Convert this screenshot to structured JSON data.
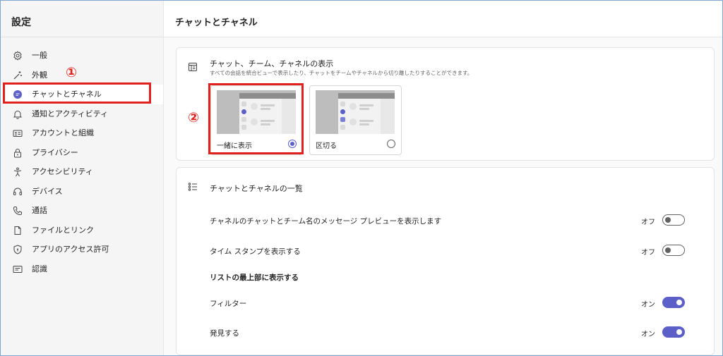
{
  "sidebar": {
    "title": "設定",
    "items": [
      {
        "label": "一般",
        "icon": "gear-icon"
      },
      {
        "label": "外観",
        "icon": "magic-wand-icon"
      },
      {
        "label": "チャットとチャネル",
        "icon": "chat-icon",
        "selected": true
      },
      {
        "label": "通知とアクティビティ",
        "icon": "bell-icon"
      },
      {
        "label": "アカウントと組織",
        "icon": "id-card-icon"
      },
      {
        "label": "プライバシー",
        "icon": "lock-icon"
      },
      {
        "label": "アクセシビリティ",
        "icon": "accessibility-icon"
      },
      {
        "label": "デバイス",
        "icon": "headset-icon"
      },
      {
        "label": "通話",
        "icon": "phone-icon"
      },
      {
        "label": "ファイルとリンク",
        "icon": "document-icon"
      },
      {
        "label": "アプリのアクセス許可",
        "icon": "shield-icon"
      },
      {
        "label": "認識",
        "icon": "recognition-icon"
      }
    ]
  },
  "annotations": {
    "one": "①",
    "two": "②",
    "color": "#e0211d"
  },
  "main": {
    "title": "チャットとチャネル",
    "display_card": {
      "title": "チャット、チーム、チャネルの表示",
      "subtitle": "すべての会話を統合ビューで表示したり、チャットをチームやチャネルから切り離したりすることができます。",
      "options": [
        {
          "label": "一緒に表示",
          "selected": true
        },
        {
          "label": "区切る",
          "selected": false
        }
      ]
    },
    "list_card": {
      "title": "チャットとチャネルの一覧",
      "rows": [
        {
          "label": "チャネルのチャットとチーム名のメッセージ プレビューを表示します",
          "state": "オフ",
          "on": false
        },
        {
          "label": "タイム スタンプを表示する",
          "state": "オフ",
          "on": false
        }
      ],
      "section_title": "リストの最上部に表示する",
      "section_rows": [
        {
          "label": "フィルター",
          "state": "オン",
          "on": true
        },
        {
          "label": "発見する",
          "state": "オン",
          "on": true
        }
      ]
    }
  },
  "colors": {
    "accent": "#5b5fc7",
    "annotation": "#e0211d",
    "sidebar_bg": "#f5f5f5"
  }
}
